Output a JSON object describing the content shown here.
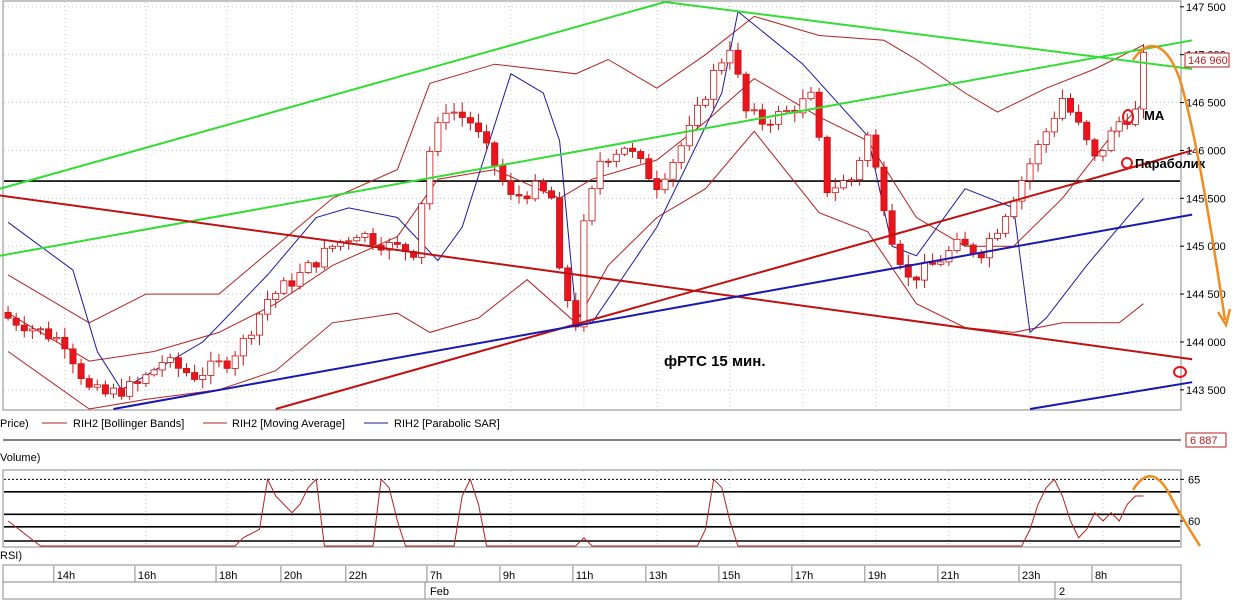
{
  "title": "фРТС    15 мин.",
  "legend_items": [
    {
      "label": "Price)",
      "color": "#000000"
    },
    {
      "label": "RIH2 [Bollinger Bands]",
      "color": "#b22222"
    },
    {
      "label": "RIH2 [Moving Average]",
      "color": "#b22222"
    },
    {
      "label": "RIH2 [Parabolic SAR]",
      "color": "#1a1aa0"
    }
  ],
  "volume_label": "Volume)",
  "volume_value": "6 887",
  "rsi_label": "RSI)",
  "price_marker": "146 960",
  "annotations": {
    "ma": "MA",
    "sar": "Параболик"
  },
  "x_labels": [
    "14h",
    "16h",
    "18h",
    "20h",
    "22h",
    "7h",
    "9h",
    "11h",
    "13h",
    "15h",
    "17h",
    "19h",
    "21h",
    "23h",
    "8h"
  ],
  "date_labels": [
    "Feb",
    "2"
  ],
  "colors": {
    "up": "#ffffff",
    "down": "#e8141e",
    "candle_edge": "#c81414",
    "bollinger": "#b22222",
    "sar": "#1a1aa0",
    "green": "#33dd33",
    "red_trend": "#c01010",
    "blue_trend": "#1818b0",
    "orange": "#f08c20",
    "grid": "#c8c8c8"
  },
  "chart_data": [
    {
      "type": "candlestick",
      "title": "фРТС    15 мин.",
      "y_ticks": [
        143500,
        144000,
        144500,
        145000,
        145500,
        146000,
        146500,
        147000,
        147500
      ],
      "y_tick_labels": [
        "143 500",
        "144 000",
        "144 500",
        "145 000",
        "145 500",
        "146 000",
        "146 500",
        "147 000",
        "147 500"
      ],
      "ylim": [
        143300,
        147550
      ],
      "n_bars": 145,
      "x_tick_labels": [
        "14h",
        "16h",
        "18h",
        "20h",
        "22h",
        "7h",
        "9h",
        "11h",
        "13h",
        "15h",
        "17h",
        "19h",
        "21h",
        "23h",
        "8h"
      ],
      "x_tick_bars": [
        7,
        17,
        27,
        35,
        43,
        53,
        62,
        71,
        80,
        89,
        98,
        107,
        116,
        126,
        135
      ],
      "close_path": [
        [
          0,
          144250
        ],
        [
          3,
          144150
        ],
        [
          7,
          144000
        ],
        [
          10,
          143500
        ],
        [
          12,
          143450
        ],
        [
          16,
          143550
        ],
        [
          19,
          143800
        ],
        [
          23,
          143650
        ],
        [
          27,
          143800
        ],
        [
          29,
          144000
        ],
        [
          32,
          144450
        ],
        [
          36,
          144700
        ],
        [
          40,
          145000
        ],
        [
          43,
          145150
        ],
        [
          47,
          145000
        ],
        [
          50,
          144950
        ],
        [
          52,
          146000
        ],
        [
          54,
          146450
        ],
        [
          57,
          146300
        ],
        [
          60,
          145850
        ],
        [
          62,
          145500
        ],
        [
          65,
          145600
        ],
        [
          67,
          145500
        ],
        [
          68,
          144700
        ],
        [
          70,
          144200
        ],
        [
          71,
          145200
        ],
        [
          73,
          145900
        ],
        [
          76,
          146050
        ],
        [
          78,
          145850
        ],
        [
          80,
          145650
        ],
        [
          82,
          145900
        ],
        [
          84,
          146200
        ],
        [
          87,
          146800
        ],
        [
          89,
          147100
        ],
        [
          91,
          146400
        ],
        [
          93,
          146300
        ],
        [
          96,
          146400
        ],
        [
          99,
          146550
        ],
        [
          101,
          145600
        ],
        [
          104,
          145700
        ],
        [
          106,
          146150
        ],
        [
          109,
          145100
        ],
        [
          111,
          144650
        ],
        [
          114,
          144800
        ],
        [
          117,
          145000
        ],
        [
          120,
          144950
        ],
        [
          122,
          145200
        ],
        [
          125,
          145700
        ],
        [
          128,
          146200
        ],
        [
          130,
          146550
        ],
        [
          132,
          146250
        ],
        [
          134,
          145900
        ],
        [
          137,
          146300
        ],
        [
          139,
          146400
        ],
        [
          140,
          146950
        ]
      ],
      "series": [
        {
          "name": "RIH2 [Bollinger Bands]",
          "kind": "bollinger_upper",
          "points": [
            [
              0,
              144700
            ],
            [
              10,
              144200
            ],
            [
              17,
              144500
            ],
            [
              26,
              144500
            ],
            [
              33,
              145000
            ],
            [
              40,
              145500
            ],
            [
              48,
              145800
            ],
            [
              52,
              146700
            ],
            [
              60,
              146900
            ],
            [
              70,
              146800
            ],
            [
              74,
              146950
            ],
            [
              80,
              146650
            ],
            [
              86,
              147000
            ],
            [
              92,
              147400
            ],
            [
              100,
              147200
            ],
            [
              108,
              147150
            ],
            [
              112,
              146950
            ],
            [
              118,
              146600
            ],
            [
              122,
              146400
            ],
            [
              128,
              146650
            ],
            [
              134,
              146850
            ],
            [
              140,
              147100
            ]
          ]
        },
        {
          "name": "RIH2 [Bollinger Bands]",
          "kind": "bollinger_lower",
          "points": [
            [
              0,
              143900
            ],
            [
              10,
              143300
            ],
            [
              17,
              143400
            ],
            [
              26,
              143500
            ],
            [
              33,
              143700
            ],
            [
              40,
              144200
            ],
            [
              48,
              144300
            ],
            [
              52,
              144100
            ],
            [
              58,
              144250
            ],
            [
              64,
              144650
            ],
            [
              70,
              144200
            ],
            [
              74,
              144800
            ],
            [
              80,
              145300
            ],
            [
              86,
              145600
            ],
            [
              92,
              146200
            ],
            [
              100,
              145350
            ],
            [
              106,
              145150
            ],
            [
              112,
              144400
            ],
            [
              118,
              144150
            ],
            [
              124,
              144100
            ],
            [
              130,
              144200
            ],
            [
              137,
              144200
            ],
            [
              140,
              144400
            ]
          ]
        },
        {
          "name": "RIH2 [Moving Average]",
          "kind": "ma",
          "points": [
            [
              0,
              144300
            ],
            [
              10,
              143800
            ],
            [
              18,
              143900
            ],
            [
              26,
              144100
            ],
            [
              33,
              144400
            ],
            [
              40,
              144800
            ],
            [
              48,
              145100
            ],
            [
              53,
              145700
            ],
            [
              60,
              145800
            ],
            [
              68,
              145500
            ],
            [
              72,
              145700
            ],
            [
              80,
              145900
            ],
            [
              86,
              146300
            ],
            [
              92,
              146750
            ],
            [
              100,
              146350
            ],
            [
              106,
              146100
            ],
            [
              112,
              145300
            ],
            [
              118,
              145000
            ],
            [
              124,
              145000
            ],
            [
              130,
              145500
            ],
            [
              136,
              146150
            ],
            [
              140,
              146500
            ]
          ]
        },
        {
          "name": "RIH2 [Parabolic SAR]",
          "kind": "sar",
          "points": [
            [
              0,
              145250
            ],
            [
              8,
              144750
            ],
            [
              11,
              143900
            ],
            [
              14,
              143500
            ],
            [
              24,
              144000
            ],
            [
              32,
              144700
            ],
            [
              38,
              145300
            ],
            [
              42,
              145400
            ],
            [
              48,
              145300
            ],
            [
              53,
              144850
            ],
            [
              56,
              145200
            ],
            [
              62,
              146800
            ],
            [
              66,
              146600
            ],
            [
              68,
              146100
            ],
            [
              70,
              144300
            ],
            [
              72,
              144200
            ],
            [
              80,
              145200
            ],
            [
              88,
              146600
            ],
            [
              90,
              147450
            ],
            [
              98,
              146900
            ],
            [
              106,
              146150
            ],
            [
              109,
              145000
            ],
            [
              112,
              144900
            ],
            [
              118,
              145600
            ],
            [
              124,
              145400
            ],
            [
              126,
              144100
            ],
            [
              128,
              144250
            ],
            [
              133,
              144800
            ],
            [
              140,
              145500
            ]
          ]
        }
      ],
      "trendlines": [
        {
          "color": "green",
          "points": [
            [
              -1,
              145600
            ],
            [
              81,
              147550
            ]
          ]
        },
        {
          "color": "green",
          "points": [
            [
              81,
              147550
            ],
            [
              146,
              146850
            ]
          ]
        },
        {
          "color": "green",
          "points": [
            [
              -1,
              144900
            ],
            [
              146,
              147150
            ]
          ]
        },
        {
          "color": "red_trend",
          "points": [
            [
              -1,
              145530
            ],
            [
              146,
              143820
            ]
          ]
        },
        {
          "color": "red_trend",
          "points": [
            [
              33,
              143300
            ],
            [
              146,
              146000
            ]
          ]
        },
        {
          "color": "blue_trend",
          "points": [
            [
              13,
              143300
            ],
            [
              146,
              145330
            ]
          ]
        },
        {
          "color": "blue_trend",
          "points": [
            [
              126,
              143300
            ],
            [
              146,
              143580
            ]
          ]
        }
      ],
      "horizontal_level": 145680
    },
    {
      "type": "line",
      "name": "RSI",
      "y_ticks": [
        60,
        65
      ],
      "ylim": [
        57,
        66
      ],
      "points": [
        [
          0,
          60
        ],
        [
          4,
          57
        ],
        [
          28,
          57
        ],
        [
          29,
          58
        ],
        [
          31,
          59
        ],
        [
          32,
          65
        ],
        [
          33,
          63
        ],
        [
          35,
          61
        ],
        [
          36,
          62
        ],
        [
          37,
          64
        ],
        [
          38,
          65
        ],
        [
          39,
          57
        ],
        [
          45,
          57
        ],
        [
          46,
          65
        ],
        [
          47,
          64
        ],
        [
          48,
          60
        ],
        [
          49,
          57
        ],
        [
          55,
          57
        ],
        [
          56,
          63
        ],
        [
          57,
          65
        ],
        [
          58,
          62
        ],
        [
          59,
          57
        ],
        [
          70,
          57
        ],
        [
          71,
          58
        ],
        [
          72,
          57
        ],
        [
          85,
          57
        ],
        [
          86,
          59
        ],
        [
          87,
          65
        ],
        [
          88,
          64
        ],
        [
          89,
          60
        ],
        [
          90,
          57
        ],
        [
          125,
          57
        ],
        [
          126,
          59
        ],
        [
          127,
          62
        ],
        [
          128,
          64
        ],
        [
          129,
          65
        ],
        [
          130,
          63
        ],
        [
          131,
          60
        ],
        [
          132,
          58
        ],
        [
          133,
          59
        ],
        [
          134,
          61
        ],
        [
          135,
          60
        ],
        [
          136,
          61
        ],
        [
          137,
          60
        ],
        [
          138,
          62
        ],
        [
          139,
          63
        ],
        [
          140,
          63
        ]
      ]
    }
  ]
}
